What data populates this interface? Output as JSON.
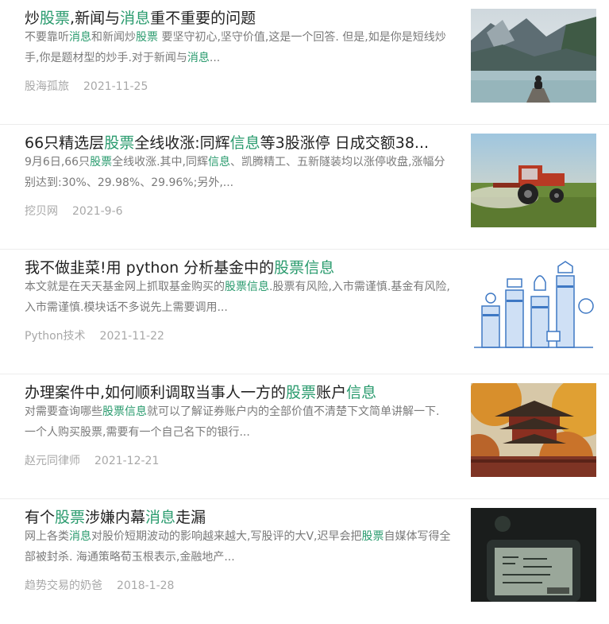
{
  "highlight_color": "#2a9b6e",
  "items": [
    {
      "title": [
        {
          "t": "炒",
          "hl": false
        },
        {
          "t": "股票",
          "hl": true
        },
        {
          "t": ",新闻与",
          "hl": false
        },
        {
          "t": "消息",
          "hl": true
        },
        {
          "t": "重不重要的问题",
          "hl": false
        }
      ],
      "desc": [
        {
          "t": "不要靠听",
          "hl": false
        },
        {
          "t": "消息",
          "hl": true
        },
        {
          "t": "和新闻炒",
          "hl": false
        },
        {
          "t": "股票",
          "hl": true
        },
        {
          "t": " 要坚守初心,坚守价值,这是一个回答. 但是,如是你是短线炒手,你是题材型的炒手.对于新闻与",
          "hl": false
        },
        {
          "t": "消息",
          "hl": true
        },
        {
          "t": "...",
          "hl": false
        }
      ],
      "source": "股海孤旅",
      "date": "2021-11-25",
      "image": "mountain-lake-photo"
    },
    {
      "title": [
        {
          "t": "66只精选层",
          "hl": false
        },
        {
          "t": "股票",
          "hl": true
        },
        {
          "t": "全线收涨:同辉",
          "hl": false
        },
        {
          "t": "信息",
          "hl": true
        },
        {
          "t": "等3股涨停 日成交额38...",
          "hl": false
        }
      ],
      "desc": [
        {
          "t": "9月6日,66只",
          "hl": false
        },
        {
          "t": "股票",
          "hl": true
        },
        {
          "t": "全线收涨.其中,同辉",
          "hl": false
        },
        {
          "t": "信息",
          "hl": true
        },
        {
          "t": "、凯腾精工、五新隧装均以涨停收盘,涨幅分别达到:30%、29.98%、29.96%;另外,...",
          "hl": false
        }
      ],
      "source": "挖贝网",
      "date": "2021-9-6",
      "image": "tractor-field-photo"
    },
    {
      "title": [
        {
          "t": "我不做韭菜!用 python 分析基金中的",
          "hl": false
        },
        {
          "t": "股票",
          "hl": true
        },
        {
          "t": "信息",
          "hl": true
        }
      ],
      "desc": [
        {
          "t": "本文就是在天天基金网上抓取基金购买的",
          "hl": false
        },
        {
          "t": "股票",
          "hl": true
        },
        {
          "t": "信息",
          "hl": true
        },
        {
          "t": ".股票有风险,入市需谨慎.基金有风险,入市需谨慎.模块话不多说先上需要调用...",
          "hl": false
        }
      ],
      "source": "Python技术",
      "date": "2021-11-22",
      "image": "finance-chart-illustration"
    },
    {
      "title": [
        {
          "t": "办理案件中,如何顺利调取当事人一方的",
          "hl": false
        },
        {
          "t": "股票",
          "hl": true
        },
        {
          "t": "账户",
          "hl": false
        },
        {
          "t": "信息",
          "hl": true
        }
      ],
      "desc": [
        {
          "t": "对需要查询哪些",
          "hl": false
        },
        {
          "t": "股票",
          "hl": true
        },
        {
          "t": "信息",
          "hl": true
        },
        {
          "t": "就可以了解证券账户内的全部价值不清楚下文简单讲解一下. 一个人购买股票,需要有一个自己名下的银行...",
          "hl": false
        }
      ],
      "source": "赵元同律师",
      "date": "2021-12-21",
      "image": "pagoda-autumn-photo"
    },
    {
      "title": [
        {
          "t": "有个",
          "hl": false
        },
        {
          "t": "股票",
          "hl": true
        },
        {
          "t": "涉嫌内幕",
          "hl": false
        },
        {
          "t": "消息",
          "hl": true
        },
        {
          "t": "走漏",
          "hl": false
        }
      ],
      "desc": [
        {
          "t": "网上各类",
          "hl": false
        },
        {
          "t": "消息",
          "hl": true
        },
        {
          "t": "对股价短期波动的影响越来越大,写股评的大V,迟早会把",
          "hl": false
        },
        {
          "t": "股票",
          "hl": true
        },
        {
          "t": "自媒体写得全部被封杀. 海通策略荀玉根表示,金融地产...",
          "hl": false
        }
      ],
      "source": "趋势交易的奶爸",
      "date": "2018-1-28",
      "image": "phone-screen-photo"
    }
  ]
}
